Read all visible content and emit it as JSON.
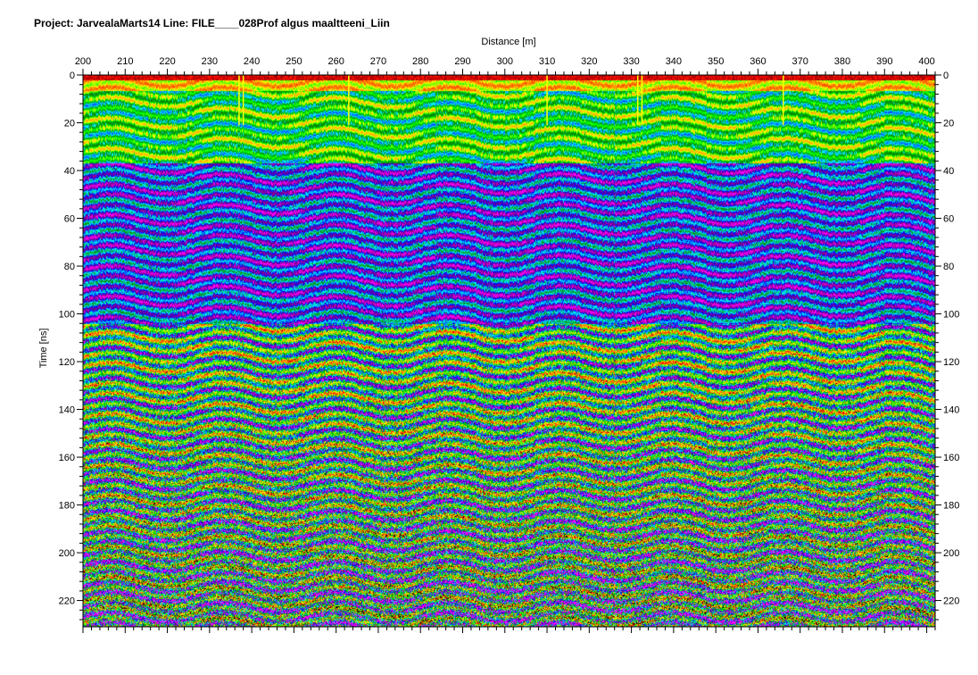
{
  "header": {
    "project_line": "Project: JarvealaMarts14  Line: FILE____028Prof algus maaltteeni_Liin"
  },
  "chart_data": {
    "type": "heatmap",
    "title": "Project: JarvealaMarts14  Line: FILE____028Prof algus maaltteeni_Liin",
    "xlabel": "Distance [m]",
    "ylabel": "Time [ns]",
    "xlim": [
      200,
      402
    ],
    "ylim": [
      0,
      231
    ],
    "y_inverted": true,
    "x_ticks": [
      200,
      210,
      220,
      230,
      240,
      250,
      260,
      270,
      280,
      290,
      300,
      310,
      320,
      330,
      340,
      350,
      360,
      370,
      380,
      390,
      400
    ],
    "y_ticks": [
      0,
      20,
      40,
      60,
      80,
      100,
      120,
      140,
      160,
      180,
      200,
      220
    ],
    "x_minor_step": 2,
    "y_minor_step": 4,
    "grid": false,
    "axes_both_sides": true,
    "marker_lines_x": [
      237,
      238,
      263,
      310,
      331.5,
      332.5,
      366
    ],
    "marker_line_color": "#ffff00",
    "colormap": [
      "#000000",
      "#ff0000",
      "#ff8000",
      "#ffff00",
      "#00ff00",
      "#008000",
      "#00ffff",
      "#0000ff",
      "#800080",
      "#ff00ff"
    ]
  }
}
